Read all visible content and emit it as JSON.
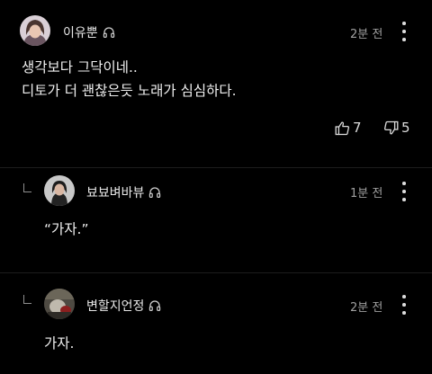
{
  "comments": [
    {
      "username": "이유뿐",
      "time": "2분 전",
      "lines": [
        "생각보다 그닥이네..",
        "디토가 더 괜찮은듯 노래가 심심하다."
      ],
      "likes": "7",
      "dislikes": "5"
    },
    {
      "username": "뵤뵤벼바뷰",
      "time": "1분 전",
      "text": "“가자.”"
    },
    {
      "username": "변할지언정",
      "time": "2분 전",
      "text": "가자."
    }
  ],
  "colors": {
    "background": "#000000",
    "text": "#f0f0f0",
    "muted": "#a0a0a0"
  },
  "icons": {
    "headphone": "headphone-icon",
    "more": "more-vert-icon",
    "like": "thumbs-up-icon",
    "dislike": "thumbs-down-icon"
  }
}
